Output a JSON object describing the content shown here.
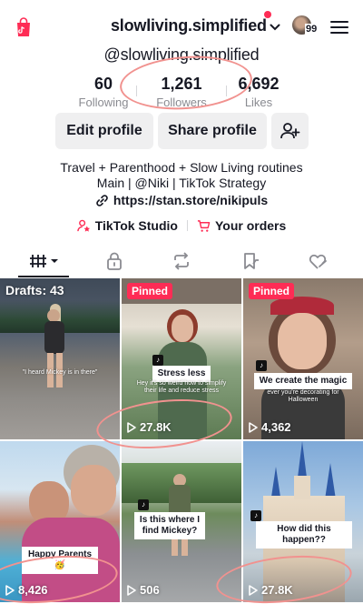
{
  "header": {
    "account_name": "slowliving.simplified",
    "avatar_count": "99",
    "handle": "@slowliving.simplified"
  },
  "stats": {
    "following": {
      "value": "60",
      "label": "Following"
    },
    "followers": {
      "value": "1,261",
      "label": "Followers"
    },
    "likes": {
      "value": "6,692",
      "label": "Likes"
    }
  },
  "buttons": {
    "edit_profile": "Edit profile",
    "share_profile": "Share profile"
  },
  "bio": {
    "line1": "Travel + Parenthood + Slow Living routines",
    "line2": "Main | @Niki | TikTok Strategy",
    "link": "https://stan.store/nikipuls"
  },
  "tools": {
    "studio": "TikTok Studio",
    "orders": "Your orders"
  },
  "tabs": [
    "videos-grid",
    "private",
    "reposts",
    "favorites",
    "liked"
  ],
  "grid": {
    "drafts_label": "Drafts: 43",
    "videos": [
      {
        "badge": "",
        "caption": "\"I heard Mickey is in there\"",
        "sub": "",
        "views": ""
      },
      {
        "badge": "Pinned",
        "caption": "Stress less",
        "sub": "Hey it's so weird how to simplify their life and reduce stress",
        "views": "27.8K"
      },
      {
        "badge": "Pinned",
        "caption": "We create the magic",
        "sub": "ever you're decorating for Halloween",
        "views": "4,362"
      },
      {
        "badge": "",
        "caption": "Happy Parents 🥳",
        "sub": "",
        "views": "8,426"
      },
      {
        "badge": "",
        "caption": "Is this where I find Mickey?",
        "sub": "",
        "views": "506"
      },
      {
        "badge": "",
        "caption": "How did this happen??",
        "sub": "",
        "views": "27.8K"
      }
    ]
  },
  "colors": {
    "accent_red": "#fe2c55",
    "annotation": "#f1928f",
    "button_bg": "#efeff0",
    "muted_text": "#8a8b91"
  }
}
